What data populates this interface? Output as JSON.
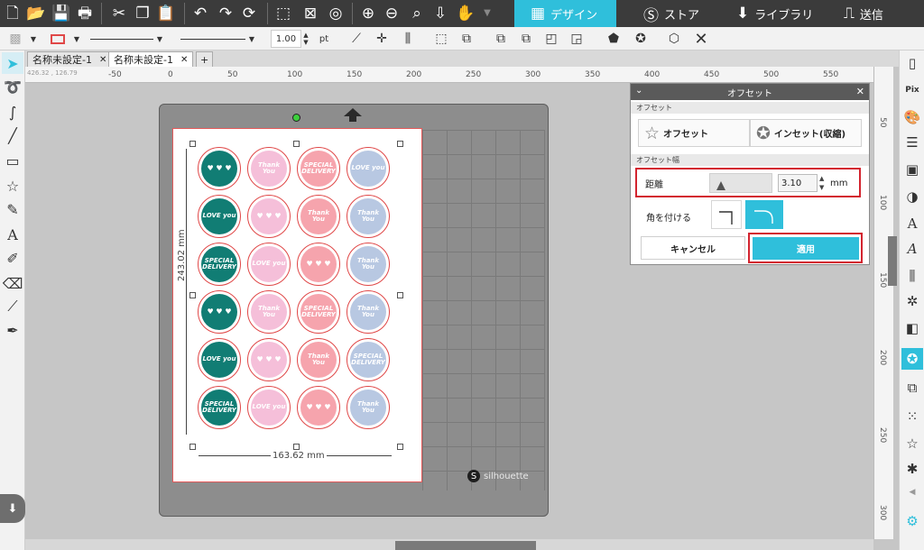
{
  "tabs": [
    {
      "label": "デザイン",
      "icon": "grid-icon"
    },
    {
      "label": "ストア",
      "icon": "store-icon"
    },
    {
      "label": "ライブラリ",
      "icon": "library-download-icon"
    },
    {
      "label": "送信",
      "icon": "cutter-icon"
    }
  ],
  "toolbar2": {
    "line_width": "1.00",
    "unit": "pt"
  },
  "doc_tabs": [
    "名称未設定-1",
    "名称未設定-1"
  ],
  "ruler": {
    "top": [
      "-50",
      "0",
      "50",
      "100",
      "150",
      "200",
      "250",
      "300",
      "350",
      "400",
      "450",
      "500",
      "550"
    ],
    "right": [
      "50",
      "100",
      "150",
      "200",
      "250",
      "300"
    ]
  },
  "coord_readout": "426.32 , 126.79",
  "dimensions": {
    "height": "243.02 mm",
    "width": "163.62 mm"
  },
  "mat_brand": "silhouette",
  "stickers": [
    [
      "",
      "Thank You",
      "SPECIAL DELIVERY",
      "LOVE you"
    ],
    [
      "LOVE you",
      "",
      "Thank You",
      "Thank You"
    ],
    [
      "SPECIAL DELIVERY",
      "LOVE you",
      "",
      "Thank You"
    ],
    [
      "",
      "Thank You",
      "SPECIAL DELIVERY",
      "Thank You"
    ],
    [
      "LOVE you",
      "",
      "Thank You",
      "SPECIAL DELIVERY"
    ],
    [
      "SPECIAL DELIVERY",
      "LOVE you",
      "",
      "Thank You"
    ]
  ],
  "panel": {
    "title": "オフセット",
    "section_mode": "オフセット",
    "btn_offset": "オフセット",
    "btn_inset": "インセット(収縮)",
    "section_width": "オフセット幅",
    "distance_label": "距離",
    "distance_value": "3.10",
    "distance_unit": "mm",
    "corner_label": "角を付ける",
    "cancel": "キャンセル",
    "apply": "適用"
  },
  "colors": {
    "accent": "#2fbfdb",
    "highlight": "#d3242f",
    "teal": "#117d74",
    "pink": "#f5bfd9",
    "coral": "#f6a4ad",
    "blue": "#b8c8e2"
  }
}
